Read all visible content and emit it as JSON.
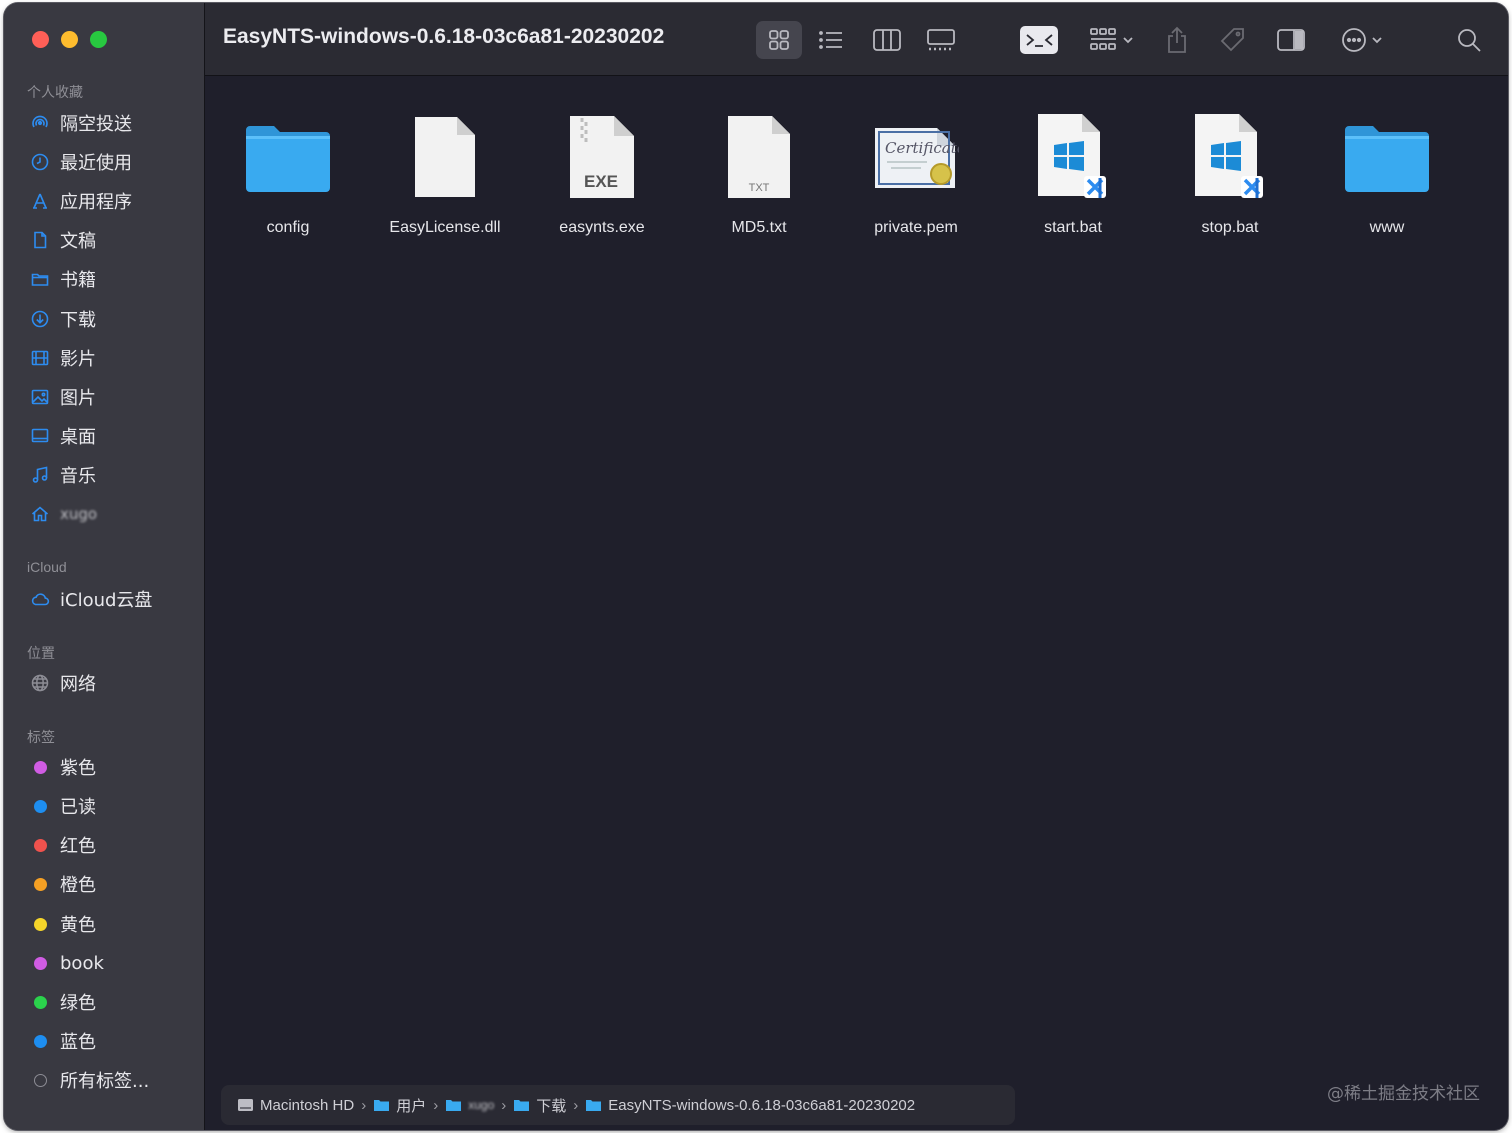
{
  "window": {
    "title": "EasyNTS-windows-0.6.18-03c6a81-20230202",
    "traffic_colors": [
      "#ff5f57",
      "#febc2e",
      "#28c840"
    ]
  },
  "sidebar": {
    "favorites_header": "个人收藏",
    "favorites": [
      {
        "label": "隔空投送",
        "icon": "airdrop-icon"
      },
      {
        "label": "最近使用",
        "icon": "clock-icon"
      },
      {
        "label": "应用程序",
        "icon": "applications-icon"
      },
      {
        "label": "文稿",
        "icon": "document-icon"
      },
      {
        "label": "书籍",
        "icon": "folder-icon"
      },
      {
        "label": "下载",
        "icon": "download-icon"
      },
      {
        "label": "影片",
        "icon": "film-icon"
      },
      {
        "label": "图片",
        "icon": "photo-icon"
      },
      {
        "label": "桌面",
        "icon": "desktop-icon"
      },
      {
        "label": "音乐",
        "icon": "music-icon"
      },
      {
        "label": "xugo",
        "icon": "home-icon"
      }
    ],
    "icloud_header": "iCloud",
    "icloud": [
      {
        "label": "iCloud云盘",
        "icon": "cloud-icon"
      }
    ],
    "locations_header": "位置",
    "locations": [
      {
        "label": "网络",
        "icon": "network-icon"
      }
    ],
    "tags_header": "标签",
    "tags": [
      {
        "label": "紫色",
        "color": "#d05ce3"
      },
      {
        "label": "已读",
        "color": "#1e8ef0"
      },
      {
        "label": "红色",
        "color": "#f0524d"
      },
      {
        "label": "橙色",
        "color": "#f5a024"
      },
      {
        "label": "黄色",
        "color": "#f5d52a"
      },
      {
        "label": "book",
        "color": "#d05ce3"
      },
      {
        "label": "绿色",
        "color": "#2bd24c"
      },
      {
        "label": "蓝色",
        "color": "#1e8ef0"
      },
      {
        "label": "所有标签...",
        "color": "none"
      }
    ]
  },
  "toolbar": {
    "view_modes": [
      "icon-view-icon",
      "list-view-icon",
      "column-view-icon",
      "gallery-view-icon"
    ],
    "active_view": "icon-view-icon",
    "actions": [
      "terminal-icon",
      "group-icon",
      "share-icon",
      "tag-icon",
      "preview-pane-icon",
      "more-icon",
      "search-icon"
    ]
  },
  "files": [
    {
      "name": "config",
      "type": "folder"
    },
    {
      "name": "EasyLicense.dll",
      "type": "blank"
    },
    {
      "name": "easynts.exe",
      "type": "exe",
      "badge": "EXE"
    },
    {
      "name": "MD5.txt",
      "type": "txt",
      "badge": "TXT"
    },
    {
      "name": "private.pem",
      "type": "certificate",
      "badge": "Certificate"
    },
    {
      "name": "start.bat",
      "type": "bat"
    },
    {
      "name": "stop.bat",
      "type": "bat"
    },
    {
      "name": "www",
      "type": "folder"
    }
  ],
  "pathbar": [
    {
      "label": "Macintosh HD",
      "icon": "disk-icon"
    },
    {
      "label": "用户",
      "icon": "folder-icon"
    },
    {
      "label": "xugo",
      "icon": "folder-icon"
    },
    {
      "label": "下载",
      "icon": "folder-icon"
    },
    {
      "label": "EasyNTS-windows-0.6.18-03c6a81-20230202",
      "icon": "folder-icon"
    }
  ],
  "watermark": "@稀土掘金技术社区"
}
